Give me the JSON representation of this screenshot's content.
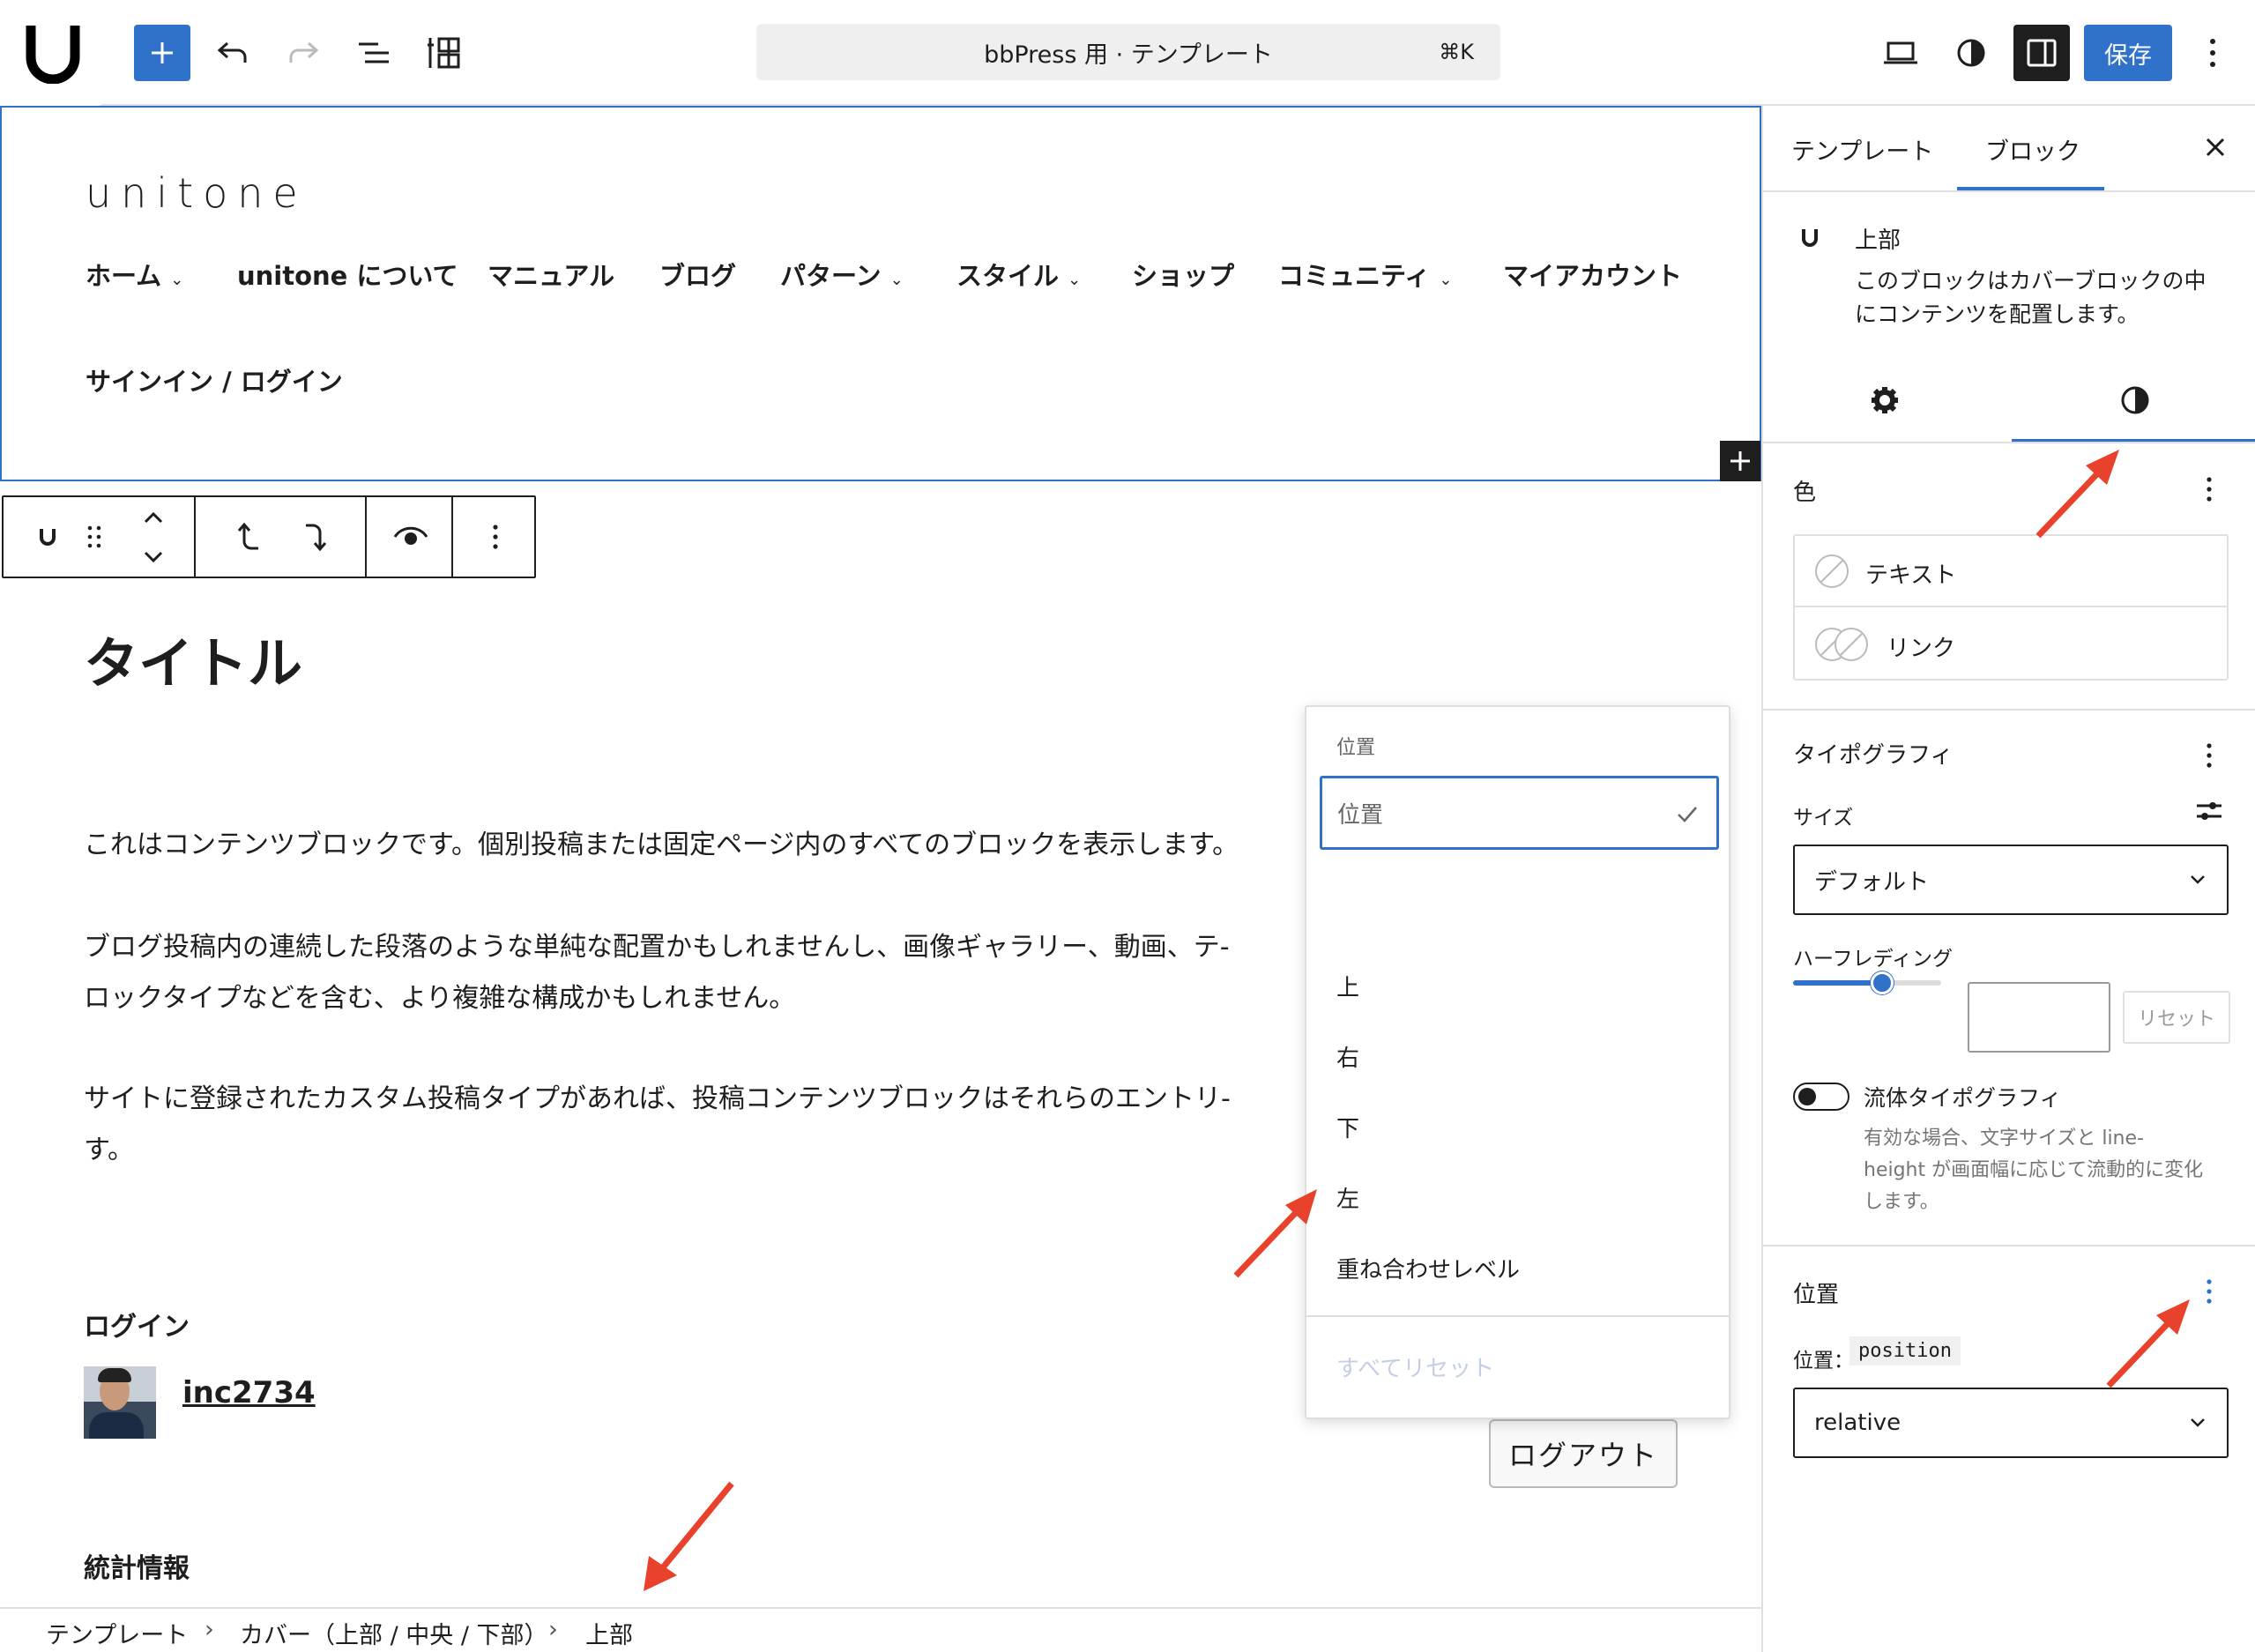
{
  "topbar": {
    "logo_text": "U",
    "command_title": "bbPress 用 · テンプレート",
    "command_shortcut": "⌘K",
    "save_label": "保存"
  },
  "site": {
    "title": "unitone",
    "nav": [
      "ホーム",
      "unitone について",
      "マニュアル",
      "ブログ",
      "パターン",
      "スタイル",
      "ショップ",
      "コミュニティ",
      "マイアカウント",
      "サインイン / ログイン"
    ]
  },
  "content": {
    "heading": "タイトル",
    "paragraphs": [
      "これはコンテンツブロックです。個別投稿または固定ページ内のすべてのブロックを表示します。",
      "ブログ投稿内の連続した段落のような単純な配置かもしれませんし、画像ギャラリー、動画、テ-",
      "ロックタイプなどを含む、より複雑な構成かもしれません。",
      "サイトに登録されたカスタム投稿タイプがあれば、投稿コンテンツブロックはそれらのエントリ-",
      "す。"
    ],
    "login_heading": "ログイン",
    "username": "inc2734",
    "logout_label": "ログアウト",
    "stats_heading": "統計情報"
  },
  "dropdown": {
    "label": "位置",
    "selected": "位置",
    "items": [
      "上",
      "右",
      "下",
      "左",
      "重ね合わせレベル"
    ],
    "reset_all": "すべてリセット"
  },
  "breadcrumb": [
    "テンプレート",
    "カバー（上部 / 中央 / 下部）",
    "上部"
  ],
  "sidebar": {
    "tabs": [
      "テンプレート",
      "ブロック"
    ],
    "block_name": "上部",
    "block_desc_1": "このブロックはカバーブロックの中",
    "block_desc_2": "にコンテンツを配置します。",
    "color_heading": "色",
    "color_items": [
      "テキスト",
      "リンク"
    ],
    "typography_heading": "タイポグラフィ",
    "size_label": "サイズ",
    "size_value": "デフォルト",
    "half_leading_label": "ハーフレディング",
    "half_leading_value": 0.6,
    "half_leading_input": "",
    "reset_label": "リセット",
    "fluid_label": "流体タイポグラフィ",
    "fluid_desc_1": "有効な場合、文字サイズと line-",
    "fluid_desc_2": "height が画面幅に応じて流動的に変化",
    "fluid_desc_3": "します。",
    "position_heading": "位置",
    "position_label": "位置：",
    "position_code": "position",
    "position_value": "relative"
  },
  "colors": {
    "accent": "#3072c9",
    "annotation_arrow": "#e8412c"
  }
}
